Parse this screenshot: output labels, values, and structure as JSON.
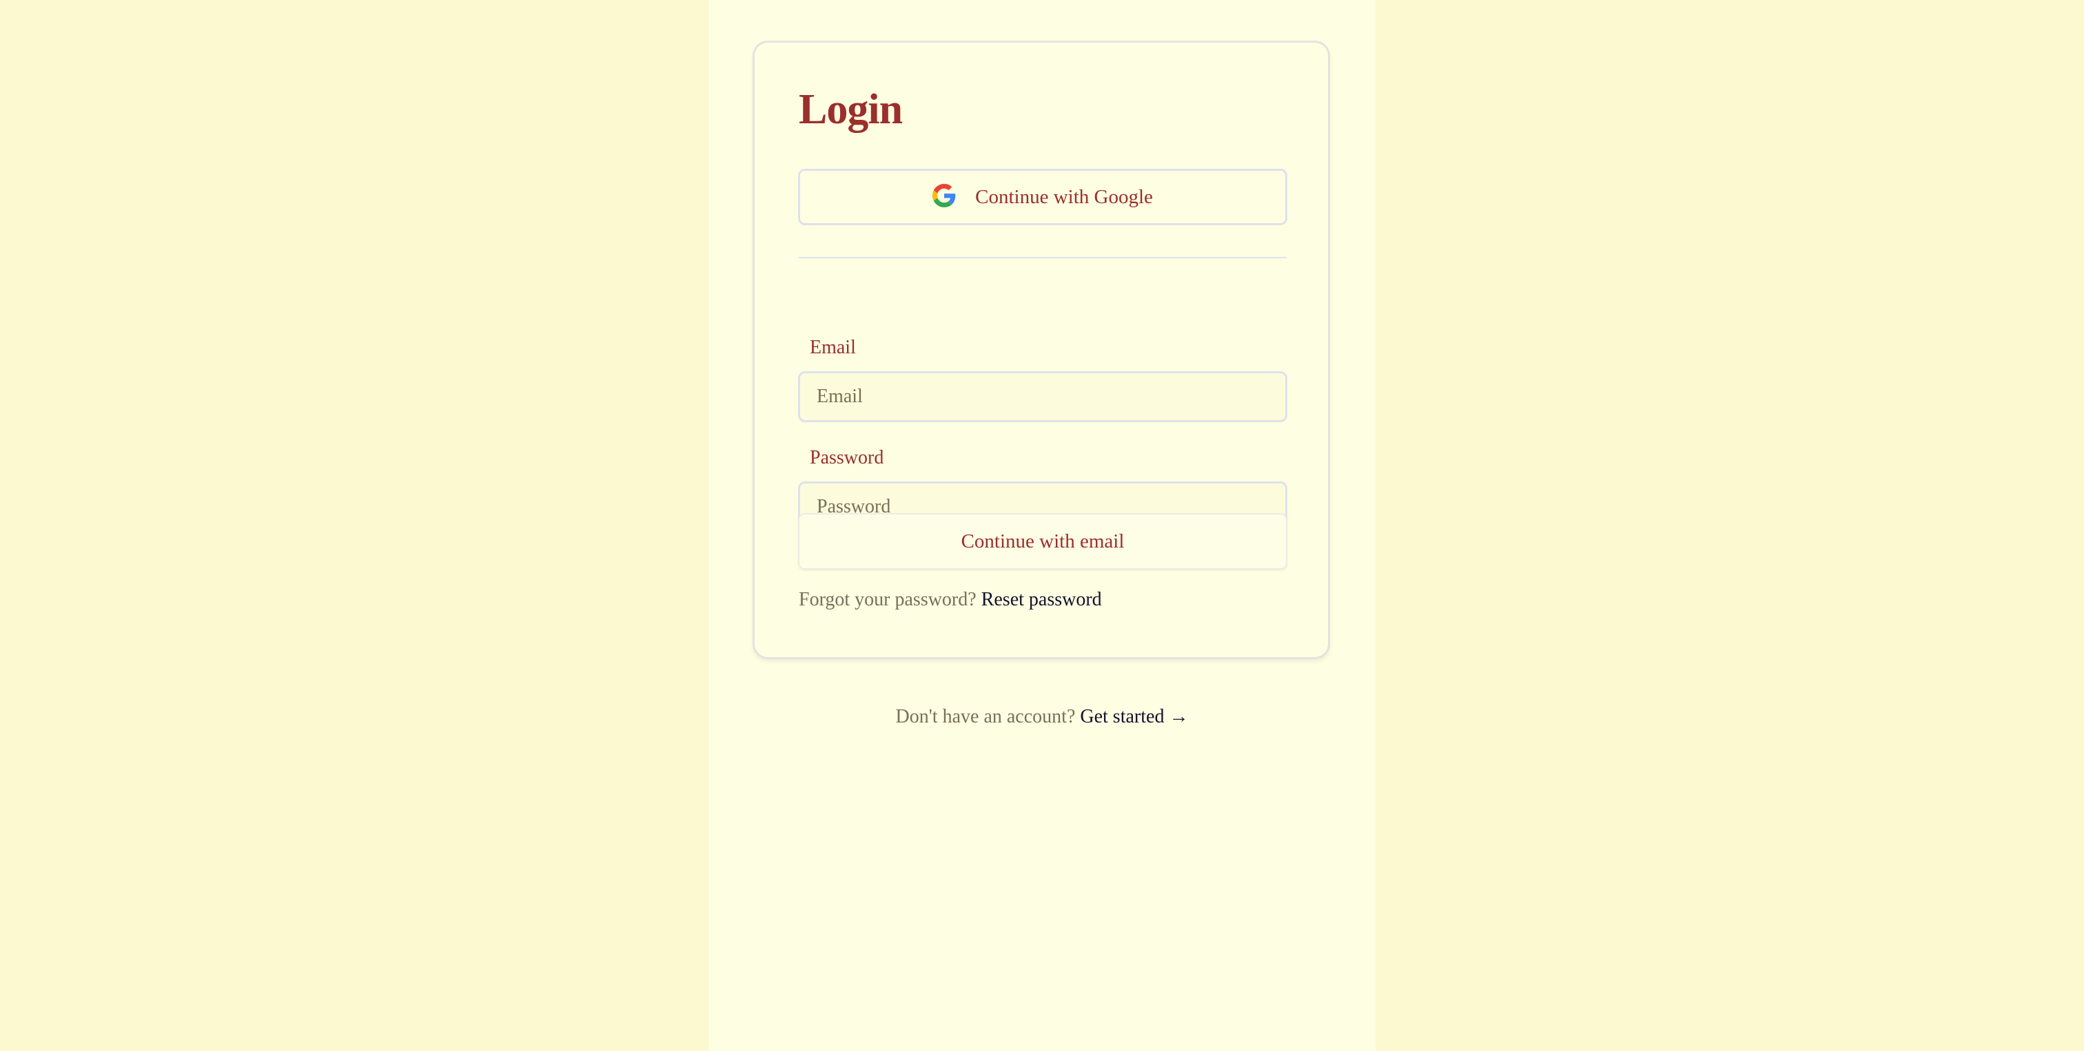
{
  "login": {
    "title": "Login",
    "google_button_label": "Continue with Google",
    "email": {
      "label": "Email",
      "placeholder": "Email",
      "value": ""
    },
    "password": {
      "label": "Password",
      "placeholder": "Password",
      "value": ""
    },
    "email_button_label": "Continue with email",
    "forgot_text": "Forgot your password?",
    "reset_link": "Reset password"
  },
  "signup": {
    "prompt": "Don't have an account?",
    "link": "Get started →"
  },
  "icons": {
    "google": "google-icon"
  },
  "colors": {
    "page_background": "#fcf8cf",
    "column_background": "#fefee3",
    "accent": "#9a2f2c",
    "muted_text": "#77705b",
    "link_text": "#12122a",
    "border": "#dee2ea"
  }
}
